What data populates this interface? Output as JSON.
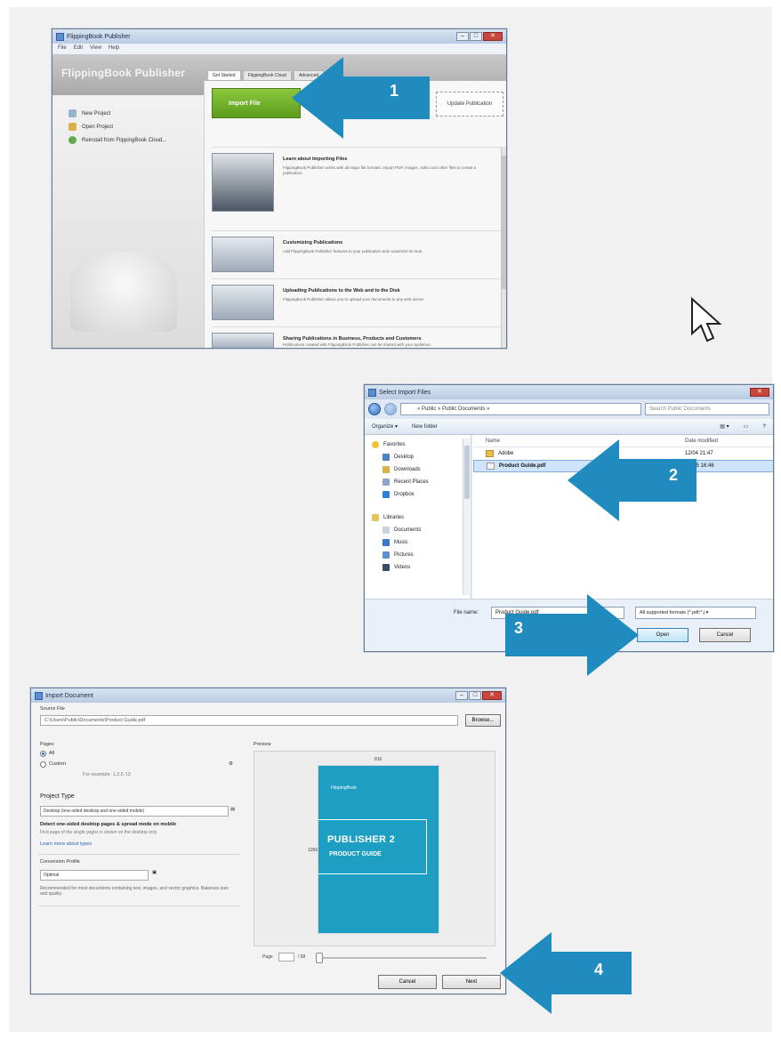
{
  "colors": {
    "arrow": "#1f8bbf",
    "import_button": "#6eaa2a",
    "cover": "#1d9ec3"
  },
  "steps": {
    "s1": "1",
    "s2": "2",
    "s3": "3",
    "s4": "4"
  },
  "publisher": {
    "title": "FlippingBook Publisher",
    "menu": [
      "File",
      "Edit",
      "View",
      "Help"
    ],
    "brand": "FlippingBook Publisher",
    "left_items": [
      "New Project",
      "Open Project",
      "Reinstall from FlippingBook Cloud..."
    ],
    "tabs": [
      "Get Started",
      "FlippingBook Cloud",
      "Advanced"
    ],
    "import_button": "Import File",
    "second_button": "Update Publication",
    "features": [
      {
        "title": "Learn about Importing Files",
        "desc": "FlippingBook Publisher works with all major file formats. Import PDF, images, video and other files to create a publication."
      },
      {
        "title": "Customizing Publications",
        "desc": "Add FlippingBook Publisher features to your publication and customize its look."
      },
      {
        "title": "Uploading Publications to the Web and to the Disk",
        "desc": "FlippingBook Publisher allows you to upload your documents to any web server."
      },
      {
        "title": "Sharing Publications in Business, Products and Customers",
        "desc": "Publications created with FlippingBook Publisher can be shared with your audience."
      }
    ]
  },
  "file_dialog": {
    "title": "Select Import Files",
    "address": "« Public » Public Documents »",
    "search": "Search Public Documents",
    "organize": "Organize ▾",
    "new_folder": "New folder",
    "nav": {
      "favorites": "Favorites",
      "fav_items": [
        "Desktop",
        "Downloads",
        "Recent Places",
        "Dropbox"
      ],
      "libraries": "Libraries",
      "lib_items": [
        "Documents",
        "Music",
        "Pictures",
        "Videos"
      ]
    },
    "columns": {
      "name": "Name",
      "date": "Date modified"
    },
    "files": [
      {
        "name": "Adobe",
        "date": "12/04 21:47"
      },
      {
        "name": "Product Guide.pdf",
        "date": "12/05 16:46"
      }
    ],
    "filename_label": "File name:",
    "filename_value": "Product Guide.pdf",
    "filetype": "All supported formats (*.pdf;*.j ▾",
    "open": "Open",
    "cancel": "Cancel"
  },
  "import_doc": {
    "title": "Import Document",
    "source_label": "Source File",
    "source_path": "C:\\Users\\Public\\Documents\\Product Guide.pdf",
    "browse": "Browse...",
    "pages_label": "Pages",
    "pages_all": "All",
    "pages_custom": "Custom",
    "pages_example": "For example: 1,3,5-12",
    "project_type_label": "Project Type",
    "project_type_value": "Desktop (one-sided desktop and one-sided mobile)",
    "option_bold": "Detect one-sided desktop pages & spread mode on mobile",
    "option_desc": "First page of the single pages is shown on the desktop only",
    "learn_more": "Learn more about types",
    "conversion_label": "Conversion Profile",
    "conversion_value": "Optimal",
    "conversion_desc": "Recommended for most documents containing text, images, and vector graphics. Balances size and quality.",
    "preview_label": "Preview",
    "cover_logo": "FlippingBook",
    "cover_title": "PUBLISHER 2",
    "cover_subtitle": "PRODUCT GUIDE",
    "dim_w": "816",
    "dim_h": "1056",
    "page_label": "Page",
    "page_of": "/ 58",
    "cancel": "Cancel",
    "next": "Next"
  }
}
